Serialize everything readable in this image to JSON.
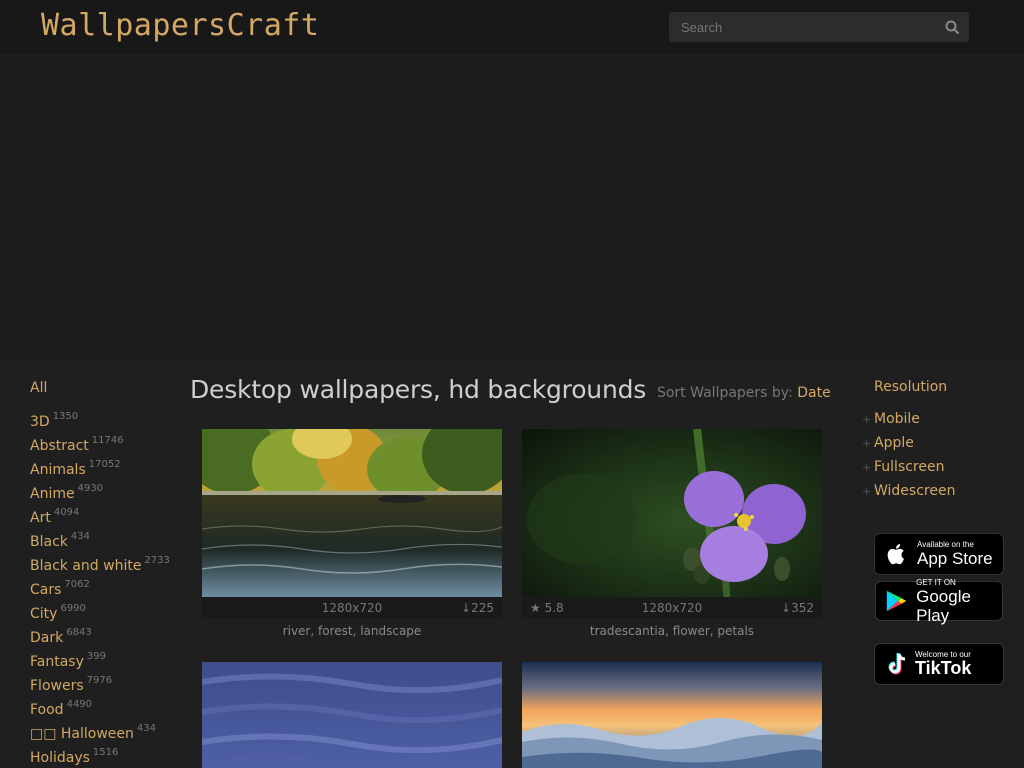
{
  "header": {
    "logo": "WallpapersCraft",
    "search_placeholder": "Search"
  },
  "sidebar": {
    "all_label": "All",
    "categories": [
      {
        "name": "3D",
        "count": "1350"
      },
      {
        "name": "Abstract",
        "count": "11746"
      },
      {
        "name": "Animals",
        "count": "17052"
      },
      {
        "name": "Anime",
        "count": "4930"
      },
      {
        "name": "Art",
        "count": "4094"
      },
      {
        "name": "Black",
        "count": "434"
      },
      {
        "name": "Black and white",
        "count": "2733"
      },
      {
        "name": "Cars",
        "count": "7062"
      },
      {
        "name": "City",
        "count": "6990"
      },
      {
        "name": "Dark",
        "count": "6843"
      },
      {
        "name": "Fantasy",
        "count": "399"
      },
      {
        "name": "Flowers",
        "count": "7976"
      },
      {
        "name": "Food",
        "count": "4490"
      },
      {
        "name": "□□ Halloween",
        "count": "434"
      },
      {
        "name": "Holidays",
        "count": "1516"
      }
    ]
  },
  "main": {
    "title": "Desktop wallpapers, hd backgrounds",
    "sort_label": "Sort Wallpapers by:",
    "sort_value": "Date",
    "wallpapers": [
      {
        "resolution": "1280x720",
        "downloads": "↓225",
        "rating": "",
        "tags": "river, forest, landscape"
      },
      {
        "resolution": "1280x720",
        "downloads": "↓352",
        "rating": "★ 5.8",
        "tags": "tradescantia, flower, petals"
      },
      {
        "resolution": "",
        "downloads": "",
        "rating": "",
        "tags": ""
      },
      {
        "resolution": "",
        "downloads": "",
        "rating": "",
        "tags": ""
      }
    ]
  },
  "right": {
    "resolution_title": "Resolution",
    "items": [
      "Mobile",
      "Apple",
      "Fullscreen",
      "Widescreen"
    ],
    "appstore": {
      "small": "Available on the",
      "big": "App Store"
    },
    "googleplay": {
      "small": "GET IT ON",
      "big": "Google Play"
    },
    "tiktok": {
      "small": "Welcome to our",
      "big": "TikTok"
    }
  },
  "colors": {
    "accent": "#d4a862",
    "background": "#1f1f1f",
    "header": "#181818"
  }
}
